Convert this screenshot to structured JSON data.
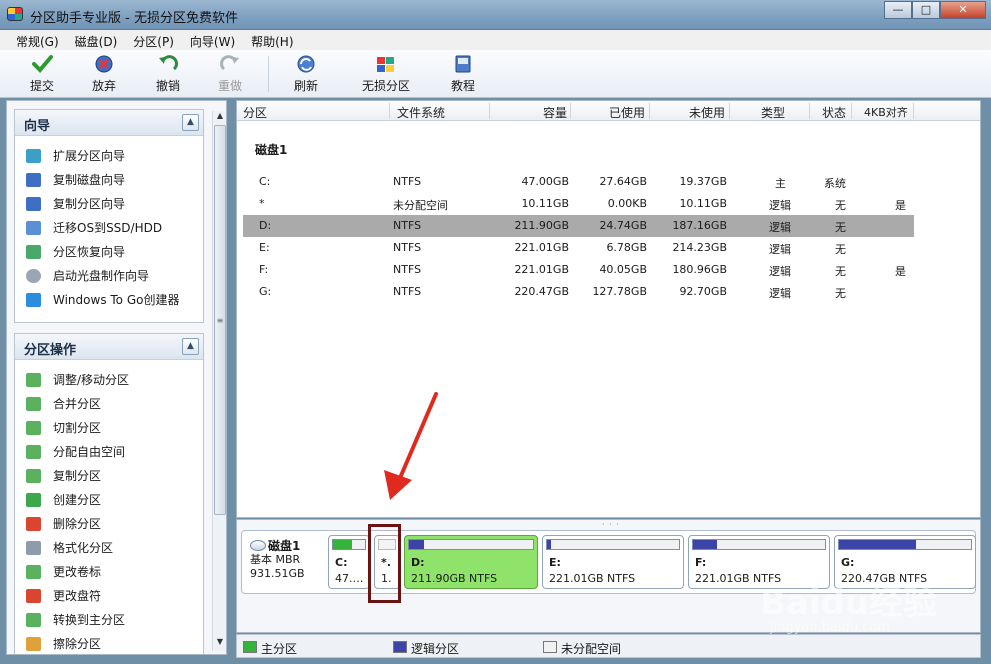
{
  "window": {
    "title": "分区助手专业版 - 无损分区免费软件",
    "min_label": "—",
    "max_label": "□",
    "close_label": "✕"
  },
  "menu": [
    "常规(G)",
    "磁盘(D)",
    "分区(P)",
    "向导(W)",
    "帮助(H)"
  ],
  "toolbar": {
    "commit": "提交",
    "discard": "放弃",
    "undo": "撤销",
    "redo": "重做",
    "refresh": "刷新",
    "lossless": "无损分区",
    "tutorial": "教程"
  },
  "wizard_panel": {
    "title": "向导",
    "items": [
      "扩展分区向导",
      "复制磁盘向导",
      "复制分区向导",
      "迁移OS到SSD/HDD",
      "分区恢复向导",
      "启动光盘制作向导",
      "Windows To Go创建器"
    ]
  },
  "ops_panel": {
    "title": "分区操作",
    "items": [
      "调整/移动分区",
      "合并分区",
      "切割分区",
      "分配自由空间",
      "复制分区",
      "创建分区",
      "删除分区",
      "格式化分区",
      "更改卷标",
      "更改盘符",
      "转换到主分区",
      "擦除分区"
    ]
  },
  "table": {
    "headers": [
      "分区",
      "文件系统",
      "容量",
      "已使用",
      "未使用",
      "类型",
      "状态",
      "4KB对齐"
    ],
    "disk_label": "磁盘1",
    "rows": [
      {
        "part": "C:",
        "fs": "NTFS",
        "cap": "47.00GB",
        "used": "27.64GB",
        "free": "19.37GB",
        "type": "主",
        "status": "系统",
        "align": ""
      },
      {
        "part": "*",
        "fs": "未分配空间",
        "cap": "10.11GB",
        "used": "0.00KB",
        "free": "10.11GB",
        "type": "逻辑",
        "status": "无",
        "align": "是"
      },
      {
        "part": "D:",
        "fs": "NTFS",
        "cap": "211.90GB",
        "used": "24.74GB",
        "free": "187.16GB",
        "type": "逻辑",
        "status": "无",
        "align": ""
      },
      {
        "part": "E:",
        "fs": "NTFS",
        "cap": "221.01GB",
        "used": "6.78GB",
        "free": "214.23GB",
        "type": "逻辑",
        "status": "无",
        "align": ""
      },
      {
        "part": "F:",
        "fs": "NTFS",
        "cap": "221.01GB",
        "used": "40.05GB",
        "free": "180.96GB",
        "type": "逻辑",
        "status": "无",
        "align": "是"
      },
      {
        "part": "G:",
        "fs": "NTFS",
        "cap": "220.47GB",
        "used": "127.78GB",
        "free": "92.70GB",
        "type": "逻辑",
        "status": "无",
        "align": ""
      }
    ]
  },
  "diskmap": {
    "disk_name": "磁盘1",
    "disk_type": "基本 MBR",
    "disk_size": "931.51GB",
    "blocks": [
      {
        "l1": "C:",
        "l2": "47.…",
        "used_frac": 0.59
      },
      {
        "l1": "*.",
        "l2": "1.",
        "used_frac": 0.0
      },
      {
        "l1": "D:",
        "l2": "211.90GB NTFS",
        "used_frac": 0.12
      },
      {
        "l1": "E:",
        "l2": "221.01GB NTFS",
        "used_frac": 0.03
      },
      {
        "l1": "F:",
        "l2": "221.01GB NTFS",
        "used_frac": 0.18
      },
      {
        "l1": "G:",
        "l2": "220.47GB NTFS",
        "used_frac": 0.58
      }
    ]
  },
  "legend": {
    "primary": "主分区",
    "logical": "逻辑分区",
    "unallocated": "未分配空间"
  },
  "colors": {
    "selected_row": "#aaaaaa",
    "selected_block": "#8fe36a",
    "primary_fill": "#35b33a",
    "logical_fill": "#3d44a8",
    "annotation": "#6b1212",
    "arrow": "#e02a1f"
  },
  "watermark": {
    "brand": "Baidu经验",
    "url": "jingyan.baidu.com"
  }
}
